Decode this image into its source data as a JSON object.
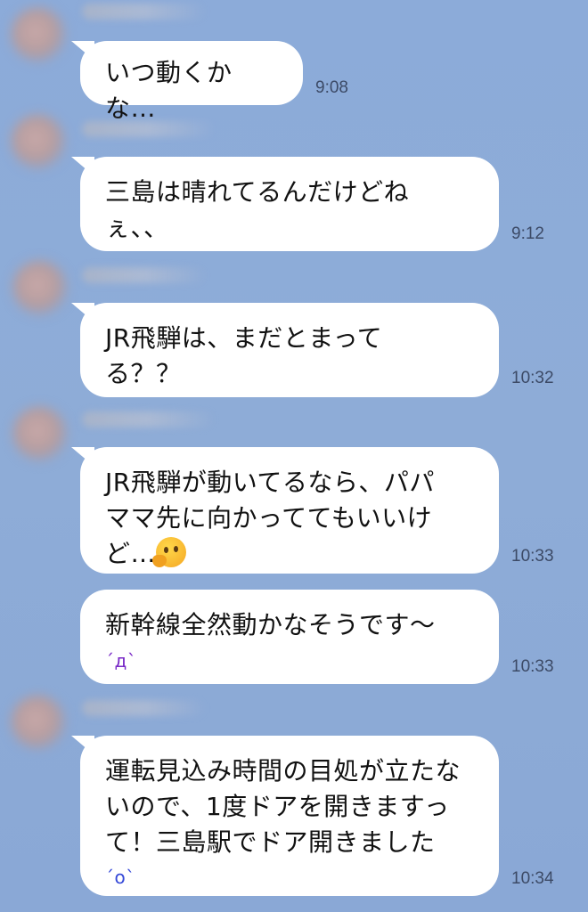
{
  "chat": {
    "messages": [
      {
        "lines": [
          "いつ動くかな…"
        ],
        "time": "9:08"
      },
      {
        "lines": [
          "三島は晴れてるんだけどね",
          "ぇ、、"
        ],
        "time": "9:12"
      },
      {
        "lines": [
          "JR飛騨は、まだとまって",
          "る？？"
        ],
        "time": "10:32"
      },
      {
        "lines": [
          "JR飛騨が動いてるなら、パパ",
          "ママ先に向かっててもいいけ",
          "ど…"
        ],
        "emoji": "thinking-face",
        "time": "10:33"
      },
      {
        "lines": [
          "新幹線全然動かなそうです〜"
        ],
        "kaomoji": "´д`",
        "time": "10:33"
      },
      {
        "lines": [
          "運転見込み時間の目処が立たな",
          "いので、1度ドアを開きますっ",
          "て！三島駅でドア開きました"
        ],
        "kaomoji": "´o`",
        "time": "10:34"
      }
    ]
  },
  "colors": {
    "background": "#8aa9d8",
    "bubble": "#ffffff",
    "text": "#111111",
    "time": "#3c4a66",
    "kaomoji_purple": "#7a2bc7",
    "kaomoji_blue": "#3549d8"
  }
}
